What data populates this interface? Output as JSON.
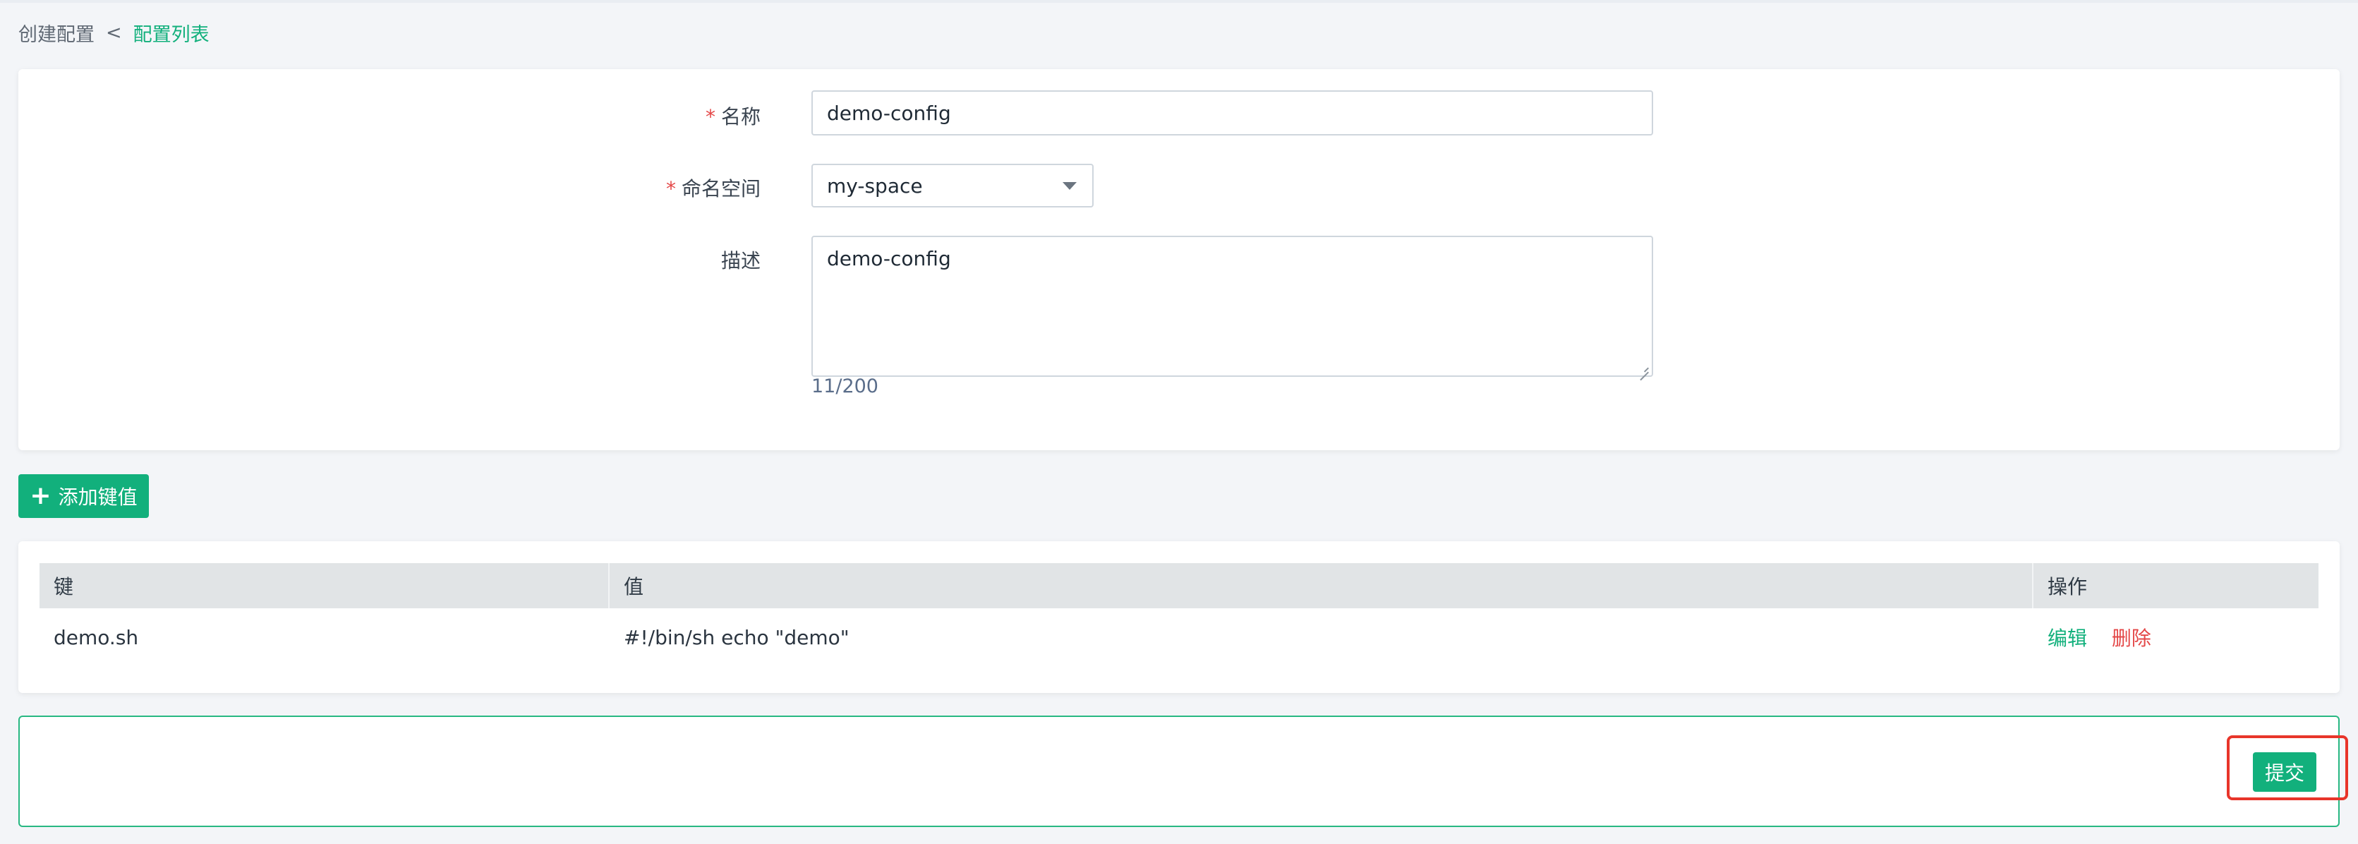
{
  "breadcrumb": {
    "current": "创建配置",
    "separator": "<",
    "link": "配置列表"
  },
  "form": {
    "name": {
      "required_mark": "*",
      "label": "名称",
      "value": "demo-config"
    },
    "namespace": {
      "required_mark": "*",
      "label": "命名空间",
      "selected": "my-space"
    },
    "description": {
      "label": "描述",
      "value": "demo-config",
      "counter": "11/200"
    }
  },
  "add_button": {
    "icon": "plus-icon",
    "label": "添加键值"
  },
  "table": {
    "columns": [
      "键",
      "值",
      "操作"
    ],
    "rows": [
      {
        "key": "demo.sh",
        "value": "#!/bin/sh echo \"demo\"",
        "actions": {
          "edit": "编辑",
          "delete": "删除"
        }
      }
    ]
  },
  "submit": {
    "label": "提交"
  },
  "colors": {
    "accent": "#12b07c",
    "danger": "#e44848",
    "highlight": "#e8352a"
  }
}
